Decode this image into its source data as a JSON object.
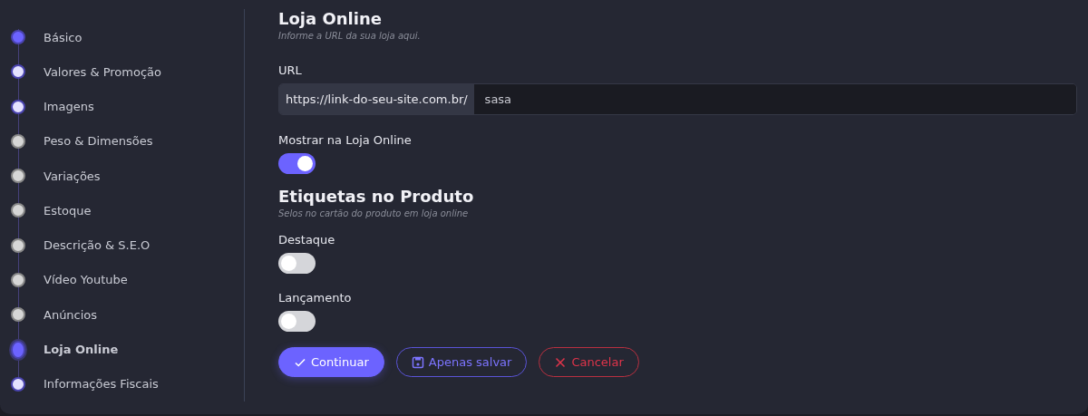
{
  "steps": [
    {
      "label": "Básico",
      "done": true,
      "visited": true,
      "selected": false
    },
    {
      "label": "Valores & Promoção",
      "done": false,
      "visited": true,
      "selected": false
    },
    {
      "label": "Imagens",
      "done": false,
      "visited": true,
      "selected": false
    },
    {
      "label": "Peso & Dimensões",
      "done": false,
      "visited": false,
      "selected": false
    },
    {
      "label": "Variações",
      "done": false,
      "visited": false,
      "selected": false
    },
    {
      "label": "Estoque",
      "done": false,
      "visited": false,
      "selected": false
    },
    {
      "label": "Descrição & S.E.O",
      "done": false,
      "visited": false,
      "selected": false
    },
    {
      "label": "Vídeo Youtube",
      "done": false,
      "visited": false,
      "selected": false
    },
    {
      "label": "Anúncios",
      "done": false,
      "visited": false,
      "selected": false
    },
    {
      "label": "Loja Online",
      "done": false,
      "visited": true,
      "selected": true
    },
    {
      "label": "Informações Fiscais",
      "done": false,
      "visited": true,
      "selected": false
    }
  ],
  "store": {
    "title": "Loja Online",
    "subtitle": "Informe a URL da sua loja aqui.",
    "url_label": "URL",
    "url_prefix": "https://link-do-seu-site.com.br/",
    "url_value": "sasa",
    "show_label": "Mostrar na Loja Online",
    "show_on": true
  },
  "tags": {
    "title": "Etiquetas no Produto",
    "subtitle": "Selos no cartão do produto em loja online",
    "items": [
      {
        "label": "Destaque",
        "on": false
      },
      {
        "label": "Lançamento",
        "on": false
      }
    ]
  },
  "buttons": [
    {
      "kind": "primary",
      "label": "Continuar"
    },
    {
      "kind": "outline",
      "label": "Apenas salvar"
    },
    {
      "kind": "danger",
      "label": "Cancelar"
    }
  ]
}
